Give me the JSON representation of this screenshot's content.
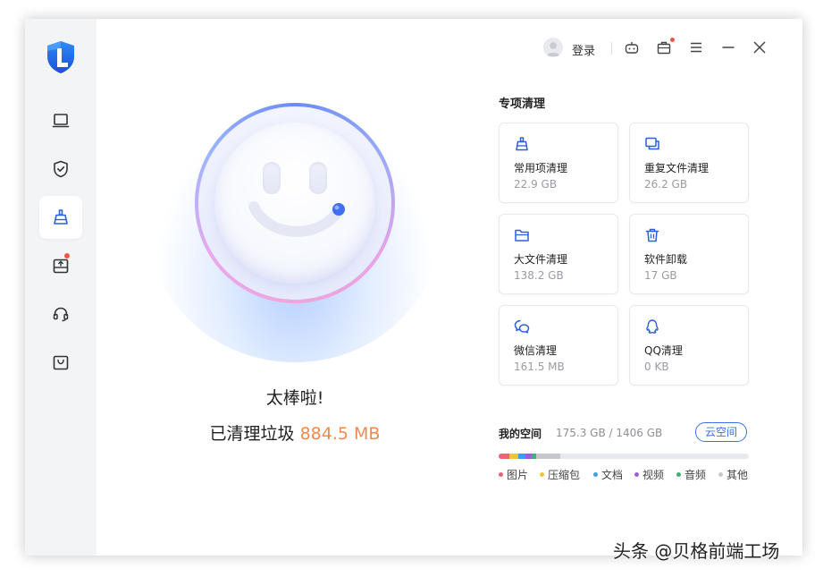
{
  "header": {
    "login_label": "登录"
  },
  "sidebar": {
    "items": [
      {
        "name": "computer",
        "icon": "laptop-icon"
      },
      {
        "name": "security",
        "icon": "shield-check-icon"
      },
      {
        "name": "cleanup",
        "icon": "broom-icon",
        "active": true
      },
      {
        "name": "software-store",
        "icon": "box-upload-icon",
        "has_badge": true
      },
      {
        "name": "support",
        "icon": "headset-icon"
      },
      {
        "name": "shop",
        "icon": "bag-icon"
      }
    ]
  },
  "main": {
    "status_title": "太棒啦!",
    "cleaned_prefix": "已清理垃圾",
    "cleaned_amount": "884.5 MB"
  },
  "special": {
    "title": "专项清理",
    "cards": [
      {
        "label": "常用项清理",
        "size": "22.9 GB",
        "icon": "broom-icon"
      },
      {
        "label": "重复文件清理",
        "size": "26.2 GB",
        "icon": "duplicate-files-icon"
      },
      {
        "label": "大文件清理",
        "size": "138.2 GB",
        "icon": "folder-icon"
      },
      {
        "label": "软件卸载",
        "size": "17 GB",
        "icon": "trash-icon"
      },
      {
        "label": "微信清理",
        "size": "161.5 MB",
        "icon": "wechat-icon"
      },
      {
        "label": "QQ清理",
        "size": "0 KB",
        "icon": "qq-icon"
      }
    ]
  },
  "space": {
    "title": "我的空间",
    "usage": "175.3 GB / 1406 GB",
    "cloud_button": "云空间",
    "segments": [
      {
        "name": "图片",
        "color": "#f0607a",
        "fraction": 0.043
      },
      {
        "name": "压缩包",
        "color": "#f5c531",
        "fraction": 0.036
      },
      {
        "name": "文档",
        "color": "#3c9ef0",
        "fraction": 0.029
      },
      {
        "name": "视频",
        "color": "#9b5de5",
        "fraction": 0.025
      },
      {
        "name": "音频",
        "color": "#3cb46e",
        "fraction": 0.018
      },
      {
        "name": "其他",
        "color": "#c6c7cc",
        "fraction": 0.096
      }
    ]
  },
  "watermark": "头条 @贝格前端工场",
  "colors": {
    "accent": "#3d6fe6",
    "amount": "#f08a4a"
  }
}
